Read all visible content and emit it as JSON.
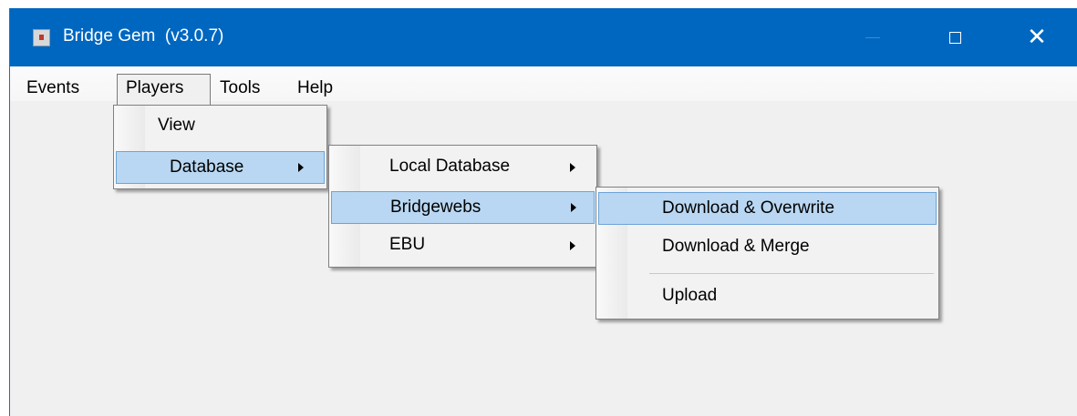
{
  "window": {
    "title": "Bridge Gem  (v3.0.7)"
  },
  "menubar": {
    "items": [
      "Events",
      "Players",
      "Tools",
      "Help"
    ]
  },
  "players_menu": {
    "items": [
      "View",
      "Database"
    ]
  },
  "database_menu": {
    "items": [
      "Local Database",
      "Bridgewebs",
      "EBU"
    ]
  },
  "bridgewebs_menu": {
    "items": [
      "Download & Overwrite",
      "Download & Merge",
      "Upload"
    ]
  },
  "colors": {
    "titlebar": "#0067c0",
    "highlight": "#b9d7f2",
    "highlight_border": "#6da4d8"
  }
}
